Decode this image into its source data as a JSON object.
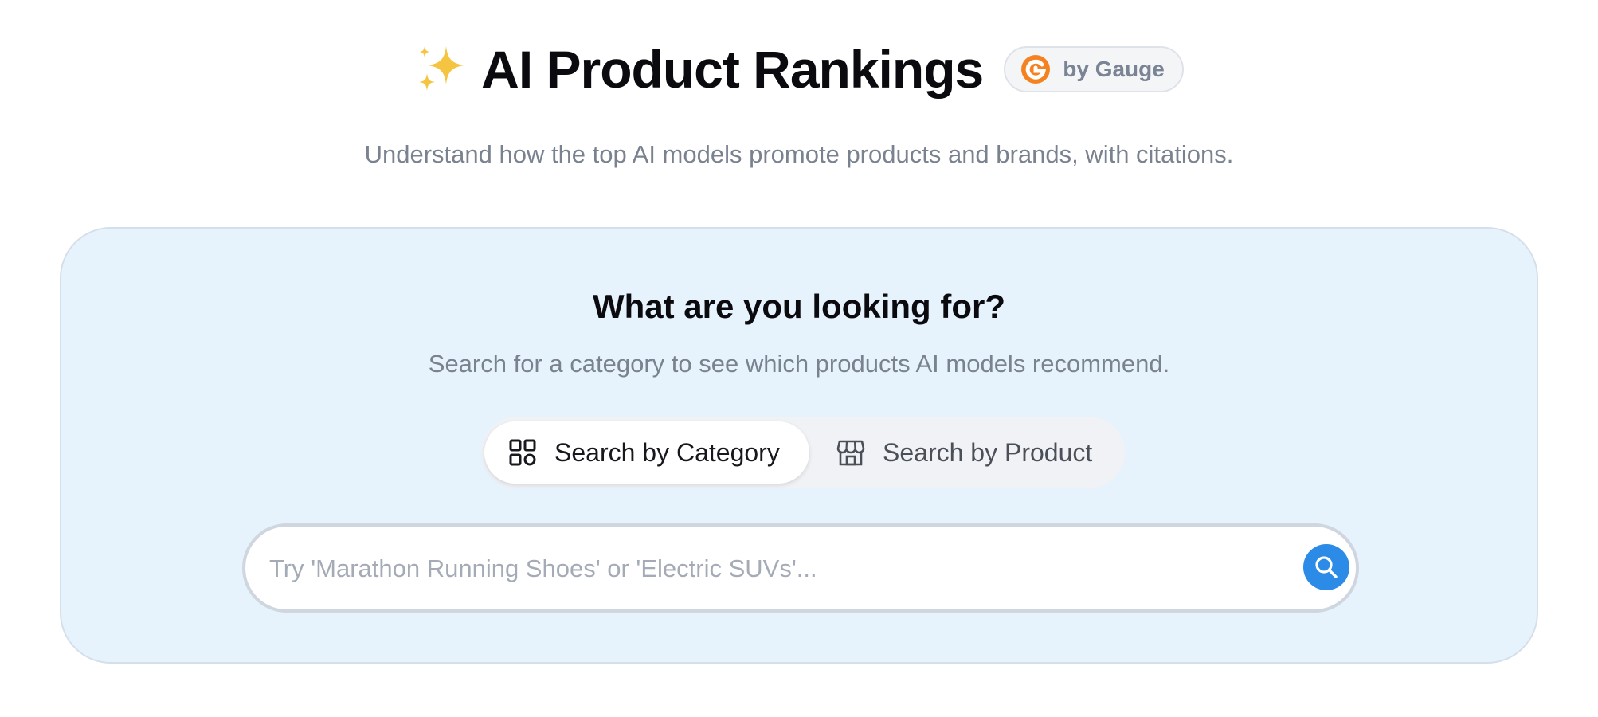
{
  "header": {
    "title": "AI Product Rankings",
    "badge_label": "by Gauge",
    "subtitle": "Understand how the top AI models promote products and brands, with citations."
  },
  "card": {
    "title": "What are you looking for?",
    "subtitle": "Search for a category to see which products AI models recommend."
  },
  "toggle": {
    "active_tab": "Search by Category",
    "category_label": "Search by Category",
    "product_label": "Search by Product"
  },
  "search": {
    "value": "",
    "placeholder": "Try 'Marathon Running Shoes' or 'Electric SUVs'..."
  },
  "icons": {
    "title": "sparkles-icon",
    "badge": "gauge-logo-icon",
    "category_tab": "grid-icon",
    "product_tab": "storefront-icon",
    "search_button": "search-icon"
  },
  "colors": {
    "accent": "#2c8be6",
    "brand_orange": "#f58220",
    "card_background": "#e6f3fd",
    "sparkle": "#f5c542"
  }
}
